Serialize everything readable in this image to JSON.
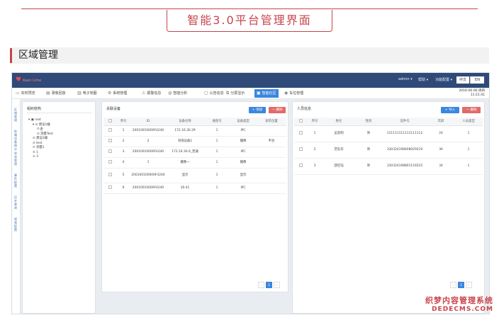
{
  "banner": {
    "title": "智能3.0平台管理界面"
  },
  "section": {
    "title": "区域管理"
  },
  "header": {
    "logo": "Keen Lime",
    "user": "admin",
    "help": "帮助",
    "settings": "功能配置",
    "lang_cn": "中文",
    "lang_en": "EN"
  },
  "date": {
    "day": "2016-06-06 周四",
    "time": "11:21:41"
  },
  "nav": [
    {
      "label": "实时预览",
      "icon": "monitor-icon"
    },
    {
      "label": "录像回放",
      "icon": "film-icon"
    },
    {
      "label": "电子地图",
      "icon": "map-icon"
    },
    {
      "label": "系统管理",
      "icon": "gear-icon"
    },
    {
      "label": "报警信息",
      "icon": "warning-icon"
    },
    {
      "label": "智能分析",
      "icon": "chart-icon"
    },
    {
      "label": "公告信息",
      "icon": "chat-icon"
    },
    {
      "label": "分屏显示",
      "icon": "screen-icon"
    },
    {
      "label": "智能社区",
      "icon": "community-icon"
    },
    {
      "label": "车位管理",
      "icon": "parking-icon"
    }
  ],
  "sidebar": [
    "区域管理",
    "前端设备统计",
    "状态管理",
    "事件配置",
    "历史查询",
    "视频配置"
  ],
  "tree": {
    "title": "组织结构",
    "nodes": [
      {
        "label": "root",
        "level": 0
      },
      {
        "label": "建设1幢",
        "level": 1
      },
      {
        "label": "A",
        "level": 2
      },
      {
        "label": "测量Test",
        "level": 2
      },
      {
        "label": "建设2幢",
        "level": 1
      },
      {
        "label": "test",
        "level": 1
      },
      {
        "label": "测量1",
        "level": 1
      },
      {
        "label": "1",
        "level": 1
      },
      {
        "label": "3",
        "level": 1
      }
    ]
  },
  "devices": {
    "title": "关联设备",
    "add": "+ 添加",
    "remove": "一 删除",
    "columns": [
      "",
      "序号",
      "ID",
      "设备名称",
      "通道号",
      "设备类型",
      "安装位置"
    ],
    "rows": [
      [
        "",
        "1",
        "20010010000F4240",
        "172.16.30.29",
        "1",
        "IPC",
        ""
      ],
      [
        "",
        "2",
        "2",
        "有限设备1",
        "1",
        "摄像",
        "平台"
      ],
      [
        "",
        "3",
        "20010010000F4240",
        "172.16.30.6_普通",
        "1",
        "IPC",
        ""
      ],
      [
        "",
        "4",
        "1",
        "摄像一",
        "1",
        "摄像",
        ""
      ],
      [
        "",
        "5",
        "200100100000F4240",
        "显示",
        "1",
        "显示",
        ""
      ],
      [
        "",
        "6",
        "20010010000F4240",
        "30.41",
        "1",
        "IPC",
        ""
      ]
    ]
  },
  "persons": {
    "title": "人员信息",
    "add": "+ 导入",
    "remove": "一 删除",
    "columns": [
      "",
      "序号",
      "姓名",
      "性别",
      "证件号",
      "年龄",
      "人员类型"
    ],
    "rows": [
      [
        "",
        "1",
        "吴思明",
        "男",
        "111111111111111112",
        "24",
        "1"
      ],
      [
        "",
        "2",
        "范先华",
        "男",
        "330324198408029219",
        "36",
        "1"
      ],
      [
        "",
        "3",
        "邵佳钰",
        "男",
        "330324198801116525",
        "34",
        "1"
      ]
    ]
  },
  "pager": {
    "prev": "‹",
    "current": "1",
    "next": "›"
  },
  "watermark": {
    "line1": "织梦内容管理系统",
    "line2": "DEDECMS.COM"
  }
}
